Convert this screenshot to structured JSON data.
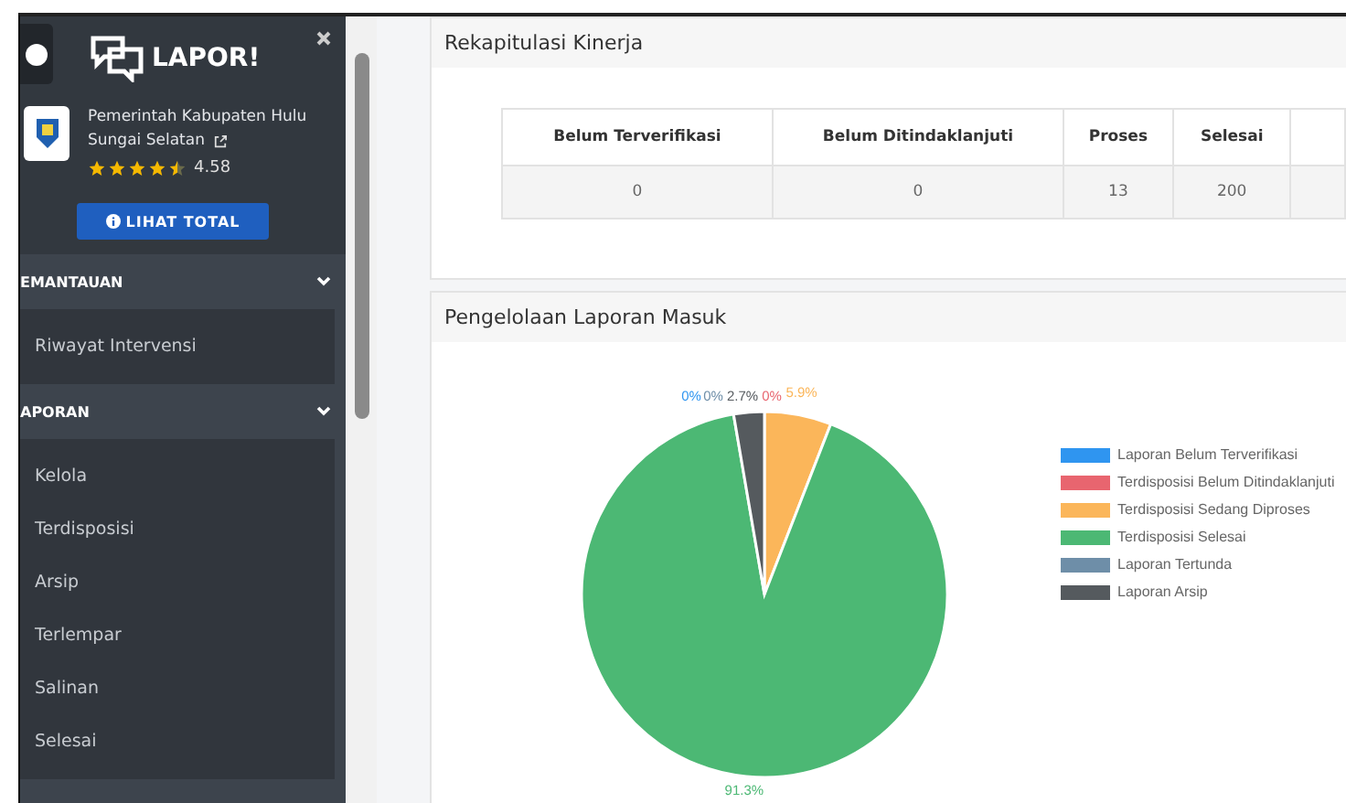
{
  "sidebar": {
    "brand": "LAPOR!",
    "org": {
      "name": "Pemerintah Kabupaten Hulu Sungai Selatan",
      "stars": 4.5,
      "rating": "4.58"
    },
    "total_button": "LIHAT TOTAL",
    "sections": [
      {
        "title": "EMANTAUAN",
        "expanded": true,
        "items": [
          "Riwayat Intervensi"
        ]
      },
      {
        "title": "APORAN",
        "expanded": true,
        "items": [
          "Kelola",
          "Terdisposisi",
          "Arsip",
          "Terlempar",
          "Salinan",
          "Selesai"
        ]
      }
    ]
  },
  "recap": {
    "title": "Rekapitulasi Kinerja",
    "columns": [
      "Belum Terverifikasi",
      "Belum Ditindaklanjuti",
      "Proses",
      "Selesai"
    ],
    "rows": [
      [
        "0",
        "0",
        "13",
        "200"
      ]
    ]
  },
  "incoming": {
    "title": "Pengelolaan Laporan Masuk",
    "chart_data": {
      "type": "pie",
      "data_labels": true,
      "categories": [
        "Laporan Belum Terverifikasi",
        "Terdisposisi Belum Ditindaklanjuti",
        "Terdisposisi Sedang Diproses",
        "Terdisposisi Selesai",
        "Laporan Tertunda",
        "Laporan Arsip"
      ],
      "values": [
        0,
        0,
        5.9,
        91.3,
        0,
        2.7
      ],
      "value_labels": [
        "0%",
        "0%",
        "5.9%",
        "91.3%",
        "0%",
        "2.7%"
      ],
      "colors": [
        "#2f95f0",
        "#e8656f",
        "#fbb65a",
        "#4cb874",
        "#6e8ea8",
        "#555a5e"
      ]
    }
  }
}
